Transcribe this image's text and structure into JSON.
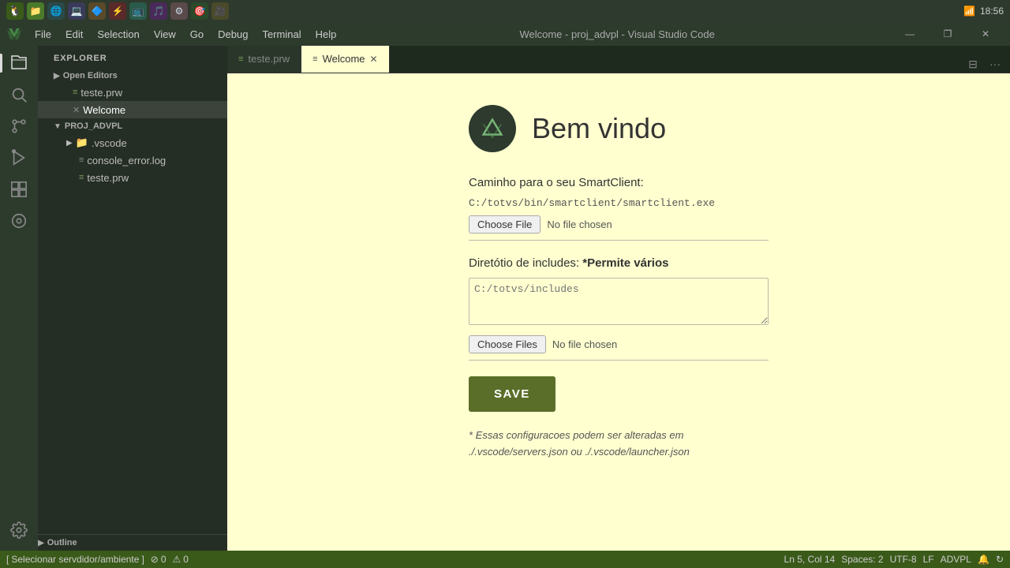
{
  "osBar": {
    "icons": [
      "app1",
      "app2",
      "app3",
      "app4",
      "app5",
      "app6",
      "app7",
      "app8",
      "app9",
      "app10",
      "app11"
    ],
    "time": "18:56"
  },
  "menuBar": {
    "logo": "vscode-logo",
    "items": [
      "File",
      "Edit",
      "Selection",
      "View",
      "Go",
      "Debug",
      "Terminal",
      "Help"
    ],
    "title": "Welcome - proj_advpl - Visual Studio Code",
    "windowControls": {
      "minimize": "—",
      "maximize": "❐",
      "close": "✕"
    }
  },
  "activityBar": {
    "icons": [
      {
        "name": "explorer-icon",
        "symbol": "⬜"
      },
      {
        "name": "search-icon",
        "symbol": "🔍"
      },
      {
        "name": "source-control-icon",
        "symbol": "⑂"
      },
      {
        "name": "debug-icon",
        "symbol": "▶"
      },
      {
        "name": "extensions-icon",
        "symbol": "⊞"
      },
      {
        "name": "remote-icon",
        "symbol": "◎"
      }
    ],
    "bottomIcons": [
      {
        "name": "settings-icon",
        "symbol": "⚙"
      }
    ]
  },
  "sidebar": {
    "header": "Explorer",
    "sections": {
      "openEditors": {
        "label": "Open Editors",
        "items": [
          {
            "name": "teste.prw",
            "icon": "📄",
            "active": false
          },
          {
            "name": "Welcome",
            "icon": "📄",
            "active": true,
            "hasClose": true
          }
        ]
      },
      "projAdvpl": {
        "label": "PROJ_ADVPL",
        "items": [
          {
            "name": ".vscode",
            "icon": "📁",
            "indent": 1
          },
          {
            "name": "console_error.log",
            "icon": "📄",
            "indent": 2
          },
          {
            "name": "teste.prw",
            "icon": "📄",
            "indent": 2
          }
        ]
      },
      "outline": {
        "label": "Outline"
      }
    }
  },
  "tabs": [
    {
      "label": "teste.prw",
      "icon": "📄",
      "active": false,
      "hasClose": false
    },
    {
      "label": "Welcome",
      "icon": "📄",
      "active": true,
      "hasClose": true
    }
  ],
  "welcome": {
    "logo": "totvs-logo",
    "title": "Bem vindo",
    "sections": {
      "smartclient": {
        "label": "Caminho para o seu SmartClient:",
        "currentPath": "C:/totvs/bin/smartclient/smartclient.exe",
        "chooseFileLabel": "Choose File",
        "noFileText": "No file chosen"
      },
      "includes": {
        "label": "Diretótio de includes:",
        "labelBold": "*Permite vários",
        "placeholder": "C:/totvs/includes",
        "chooseFilesLabel": "Choose Files",
        "noFileText": "No file chosen"
      }
    },
    "saveButton": "SAVE",
    "footerNote1": "* Essas configuracoes podem ser alteradas em",
    "footerNote2": "./.vscode/servers.json ou ./.vscode/launcher.json"
  },
  "statusBar": {
    "leftItems": [
      {
        "name": "branch-item",
        "text": "Selecionar servdidor/ambiente"
      },
      {
        "name": "error-count",
        "text": "0",
        "icon": "⊘"
      },
      {
        "name": "warning-count",
        "text": "0",
        "icon": "⚠"
      }
    ],
    "rightItems": [
      {
        "name": "position",
        "text": "Ln 5, Col 14"
      },
      {
        "name": "spaces",
        "text": "Spaces: 2"
      },
      {
        "name": "encoding",
        "text": "UTF-8"
      },
      {
        "name": "eol",
        "text": "LF"
      },
      {
        "name": "language",
        "text": "ADVPL"
      },
      {
        "name": "notification",
        "text": "🔔"
      },
      {
        "name": "sync",
        "text": "↻"
      }
    ]
  }
}
